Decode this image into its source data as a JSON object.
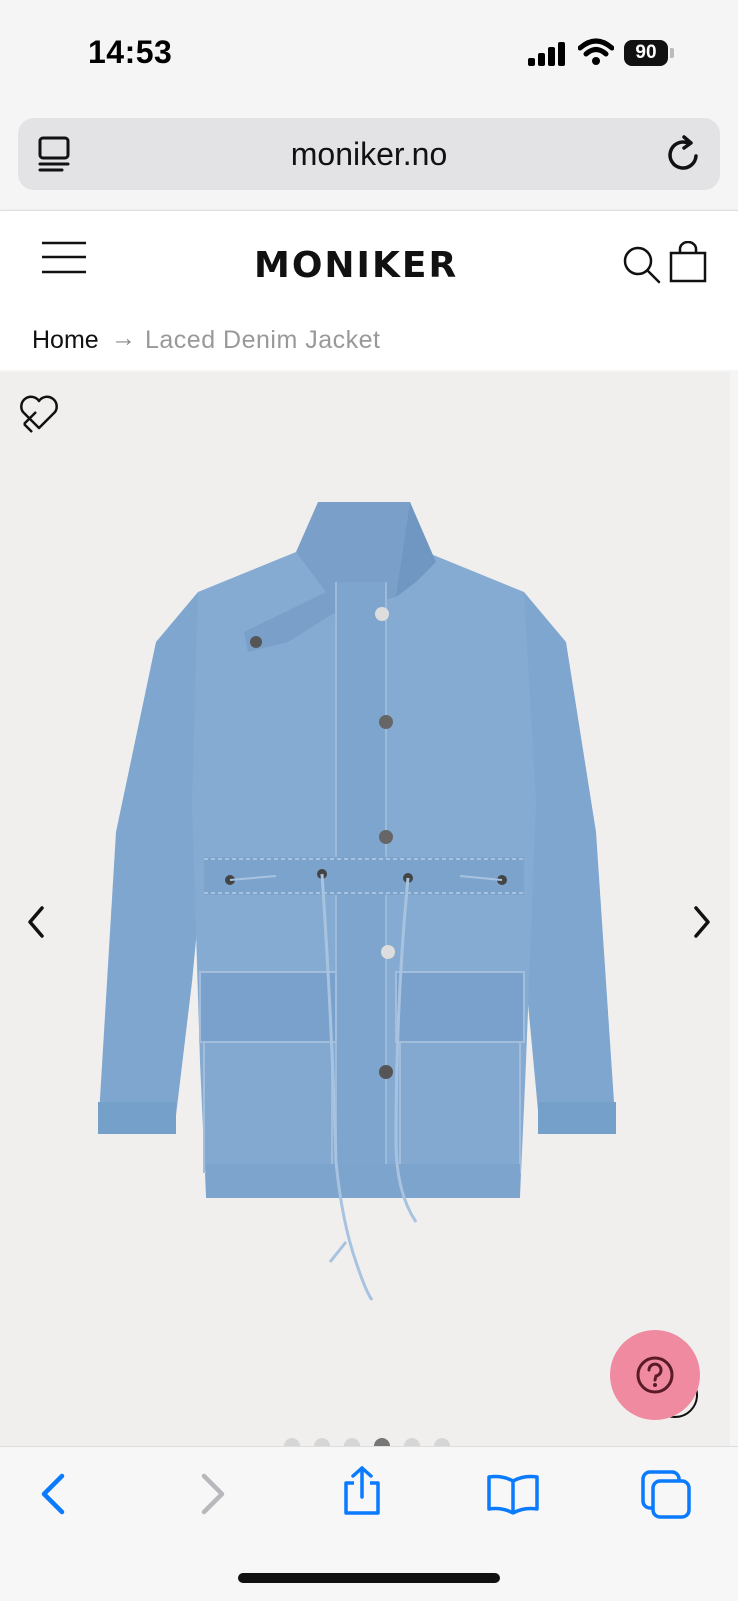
{
  "status": {
    "time": "14:53",
    "battery": "90"
  },
  "browser": {
    "url": "moniker.no"
  },
  "site": {
    "logo": "MONIKER"
  },
  "breadcrumb": {
    "home": "Home",
    "separator": "→",
    "current": "Laced Denim Jacket"
  },
  "gallery": {
    "slide_count": 6,
    "active_slide": 4
  },
  "colors": {
    "accent_ios": "#0a7aff",
    "help_button": "#f08aa0",
    "denim": "#86a9cd"
  }
}
